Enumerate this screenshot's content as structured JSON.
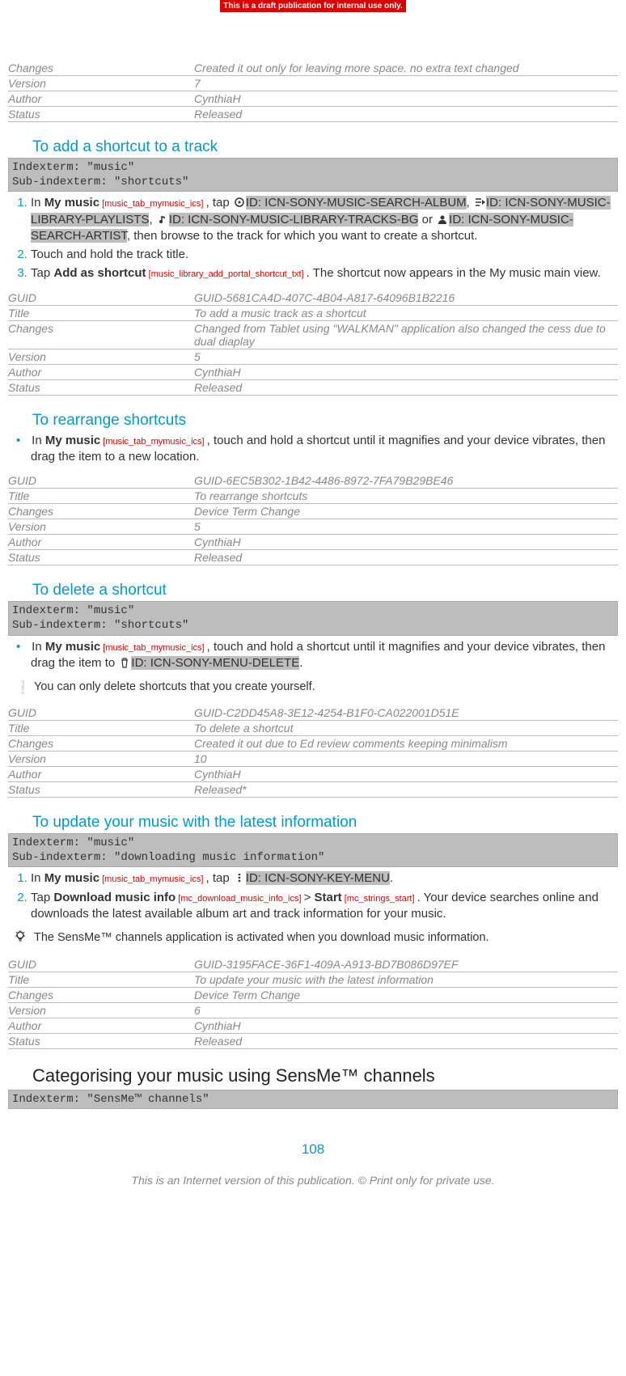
{
  "banner": "This is a draft publication for internal use only.",
  "meta0": {
    "changes_l": "Changes",
    "changes_v": "Created it out only for leaving more space. no extra text changed",
    "version_l": "Version",
    "version_v": "7",
    "author_l": "Author",
    "author_v": "CynthiaH",
    "status_l": "Status",
    "status_v": "Released"
  },
  "sec1": {
    "title": "To add a shortcut to a track",
    "index": "Indexterm: \"music\"\nSub-indexterm: \"shortcuts\"",
    "step1_pre": "In ",
    "step1_b": "My music",
    "step1_tag": " [music_tab_mymusic_ics] ",
    "step1_mid": ", tap ",
    "step1_hl1": "ID: ICN-SONY-MUSIC-SEARCH-ALBUM",
    "step1_sep1": ", ",
    "step1_hl2": "ID: ICN-SONY-MUSIC-LIBRARY-PLAYLISTS",
    "step1_sep2": ", ",
    "step1_hl3": "ID: ICN-SONY-MUSIC-LIBRARY-TRACKS-BG",
    "step1_or": " or ",
    "step1_hl4": "ID: ICN-SONY-MUSIC-SEARCH-ARTIST",
    "step1_end": ", then browse to the track for which you want to create a shortcut.",
    "step2": "Touch and hold the track title.",
    "step3_a": "Tap ",
    "step3_b": "Add as shortcut",
    "step3_tag": " [music_library_add_portal_shortcut_txt] ",
    "step3_end": ". The shortcut now appears in the My music main view."
  },
  "meta1": {
    "guid_l": "GUID",
    "guid_v": "GUID-5681CA4D-407C-4B04-A817-64096B1B2216",
    "title_l": "Title",
    "title_v": "To add a music track as a shortcut",
    "changes_l": "Changes",
    "changes_v": "Changed from Tablet using \"WALKMAN\" application also changed the cess due to dual diaplay",
    "version_l": "Version",
    "version_v": "5",
    "author_l": "Author",
    "author_v": "CynthiaH",
    "status_l": "Status",
    "status_v": "Released"
  },
  "sec2": {
    "title": "To rearrange shortcuts",
    "step_pre": "In ",
    "step_b": "My music",
    "step_tag": " [music_tab_mymusic_ics] ",
    "step_end": ", touch and hold a shortcut until it magnifies and your device vibrates, then drag the item to a new location."
  },
  "meta2": {
    "guid_l": "GUID",
    "guid_v": "GUID-6EC5B302-1B42-4486-8972-7FA79B29BE46",
    "title_l": "Title",
    "title_v": "To rearrange shortcuts",
    "changes_l": "Changes",
    "changes_v": "Device Term Change",
    "version_l": "Version",
    "version_v": "5",
    "author_l": "Author",
    "author_v": "CynthiaH",
    "status_l": "Status",
    "status_v": "Released"
  },
  "sec3": {
    "title": "To delete a shortcut",
    "index": "Indexterm: \"music\"\nSub-indexterm: \"shortcuts\"",
    "step_pre": "In ",
    "step_b": "My music",
    "step_tag": " [music_tab_mymusic_ics] ",
    "step_mid": ", touch and hold a shortcut until it magnifies and your device vibrates, then drag the item to ",
    "step_hl": "ID: ICN-SONY-MENU-DELETE",
    "step_end": ".",
    "note": "You can only delete shortcuts that you create yourself."
  },
  "meta3": {
    "guid_l": "GUID",
    "guid_v": "GUID-C2DD45A8-3E12-4254-B1F0-CA022001D51E",
    "title_l": "Title",
    "title_v": "To delete a shortcut",
    "changes_l": "Changes",
    "changes_v": "Created it out due to Ed review comments keeping minimalism",
    "version_l": "Version",
    "version_v": "10",
    "author_l": "Author",
    "author_v": "CynthiaH",
    "status_l": "Status",
    "status_v": "Released*"
  },
  "sec4": {
    "title": "To update your music with the latest information",
    "index": "Indexterm: \"music\"\nSub-indexterm: \"downloading music information\"",
    "s1_pre": "In ",
    "s1_b": "My music",
    "s1_tag": " [music_tab_mymusic_ics] ",
    "s1_mid": ", tap ",
    "s1_hl": "ID: ICN-SONY-KEY-MENU",
    "s1_end": ".",
    "s2_a": "Tap ",
    "s2_b1": "Download music info",
    "s2_tag1": " [mc_download_music_info_ics] ",
    "s2_gt": " > ",
    "s2_b2": "Start",
    "s2_tag2": " [mc_strings_start] ",
    "s2_end": ". Your device searches online and downloads the latest available album art and track information for your music.",
    "tip": "The SensMe™ channels application is activated when you download music information."
  },
  "meta4": {
    "guid_l": "GUID",
    "guid_v": "GUID-3195FACE-36F1-409A-A913-BD7B086D97EF",
    "title_l": "Title",
    "title_v": "To update your music with the latest information",
    "changes_l": "Changes",
    "changes_v": "Device Term Change",
    "version_l": "Version",
    "version_v": "6",
    "author_l": "Author",
    "author_v": "CynthiaH",
    "status_l": "Status",
    "status_v": "Released"
  },
  "sec5": {
    "title": "Categorising your music using SensMe™ channels",
    "index": "Indexterm: \"SensMe™ channels\""
  },
  "page": "108",
  "footer": "This is an Internet version of this publication. © Print only for private use."
}
